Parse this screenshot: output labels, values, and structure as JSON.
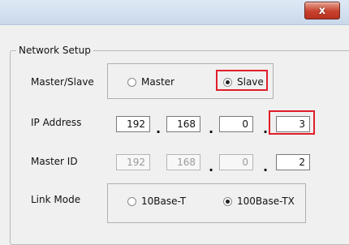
{
  "window": {
    "close_label": "x"
  },
  "network_setup": {
    "title": "Network Setup",
    "master_slave": {
      "label": "Master/Slave",
      "options": [
        "Master",
        "Slave"
      ],
      "selected": "Slave"
    },
    "ip_address": {
      "label": "IP Address",
      "octets": [
        "192",
        "168",
        "0",
        "3"
      ],
      "separator": "."
    },
    "master_id": {
      "label": "Master ID",
      "octets": [
        "192",
        "168",
        "0",
        "2"
      ],
      "separator": "."
    },
    "link_mode": {
      "label": "Link Mode",
      "options": [
        "10Base-T",
        "100Base-TX"
      ],
      "selected": "100Base-TX"
    }
  }
}
